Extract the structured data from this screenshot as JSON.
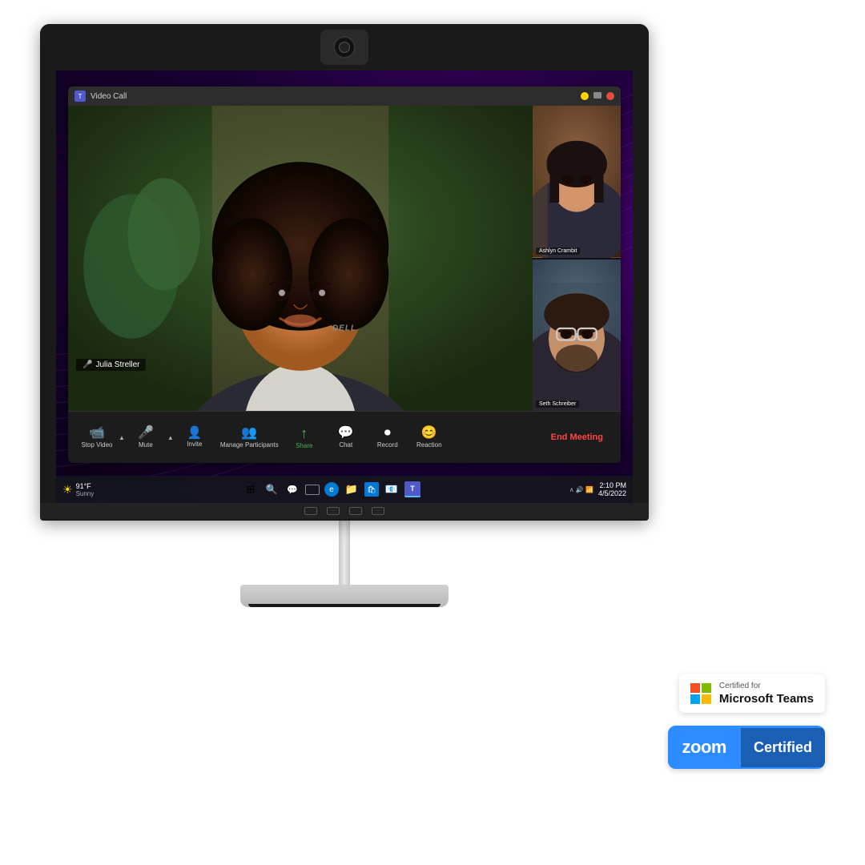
{
  "monitor": {
    "title": "Dell Monitor with Webcam",
    "dell_label": "DELL"
  },
  "video_call": {
    "title": "Video Call",
    "window_controls": {
      "minimize": "—",
      "maximize": "□",
      "close": "✕"
    },
    "main_speaker": {
      "name": "Julia Streller",
      "mic_icon": "🎤"
    },
    "participants": [
      {
        "name": "Ashlyn Crambit",
        "thumbnail_index": 1
      },
      {
        "name": "Seth Schreiber",
        "thumbnail_index": 2
      }
    ],
    "controls": [
      {
        "id": "stop-video",
        "icon": "📹",
        "label": "Stop Video",
        "has_chevron": true
      },
      {
        "id": "mute",
        "icon": "🎤",
        "label": "Mute",
        "has_chevron": true
      },
      {
        "id": "invite",
        "icon": "👤+",
        "label": "Invite",
        "has_chevron": false
      },
      {
        "id": "manage-participants",
        "icon": "👥",
        "label": "Manage Participants",
        "has_chevron": false
      },
      {
        "id": "share",
        "icon": "↑",
        "label": "Share",
        "has_chevron": false,
        "color": "green"
      },
      {
        "id": "chat",
        "icon": "💬",
        "label": "Chat",
        "has_chevron": false
      },
      {
        "id": "record",
        "icon": "⏺",
        "label": "Record",
        "has_chevron": false
      },
      {
        "id": "reaction",
        "icon": "😊",
        "label": "Reaction",
        "has_chevron": false
      }
    ],
    "end_meeting_label": "End Meeting"
  },
  "taskbar": {
    "weather": {
      "icon": "☀",
      "temp": "91°F",
      "condition": "Sunny"
    },
    "time": "2:10 PM",
    "date": "4/5/2022",
    "apps": [
      "⊞",
      "🔍",
      "💬",
      "🗂",
      "📁",
      "🌐",
      "📦",
      "📧",
      "👥"
    ]
  },
  "certifications": {
    "microsoft": {
      "top_text": "Certified for",
      "bottom_text": "Microsoft Teams"
    },
    "zoom": {
      "logo": "zoom",
      "certified": "Certified"
    }
  }
}
